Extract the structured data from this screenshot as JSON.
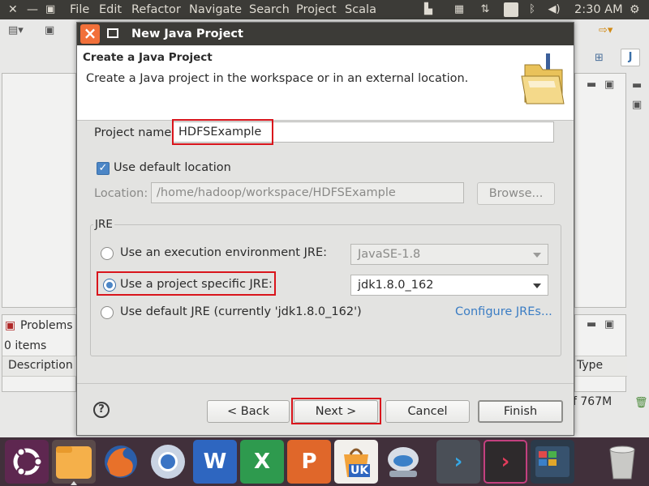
{
  "topbar": {
    "menu": [
      "File",
      "Edit",
      "Refactor",
      "Navigate",
      "Search",
      "Project",
      "Scala"
    ],
    "keyboard_layout": "Zh",
    "clock": "2:30 AM"
  },
  "eclipse": {
    "problems_title": "Problems",
    "problems_count": "0 items",
    "col_description": "Description",
    "col_type": "Type",
    "heap_status": "f 767M"
  },
  "dialog": {
    "title": "New Java Project",
    "banner_title": "Create a Java Project",
    "banner_description": "Create a Java project in the workspace or in an external location.",
    "project_name_label": "Project name:",
    "project_name_value": "HDFSExample",
    "use_default_location_label": "Use default location",
    "use_default_location_checked": true,
    "location_label": "Location:",
    "location_value": "/home/hadoop/workspace/HDFSExample",
    "browse_label": "Browse...",
    "jre_group_label": "JRE",
    "jre_option_env_label": "Use an execution environment JRE:",
    "jre_env_value": "JavaSE-1.8",
    "jre_option_specific_label": "Use a project specific JRE:",
    "jre_specific_value": "jdk1.8.0_162",
    "jre_option_default_label": "Use default JRE (currently 'jdk1.8.0_162')",
    "configure_jres_link": "Configure JREs...",
    "selected_jre_option": "specific",
    "back_label": "< Back",
    "next_label": "Next >",
    "cancel_label": "Cancel",
    "finish_label": "Finish",
    "help_icon": "?"
  },
  "dock": {
    "items": [
      "ubuntu-logo",
      "files",
      "firefox",
      "chromium",
      "wps-writer",
      "wps-spreadsheets",
      "wps-presentation",
      "software-center",
      "amazon",
      "remote-desktop",
      "terminal",
      "workspace-switcher",
      "trash"
    ],
    "amazon_badge": "UK"
  },
  "colors": {
    "highlight": "#d9151c",
    "accent": "#4c86c6",
    "link": "#3b7dc4",
    "panel": "#3c3b37",
    "dock": "#41303b"
  }
}
